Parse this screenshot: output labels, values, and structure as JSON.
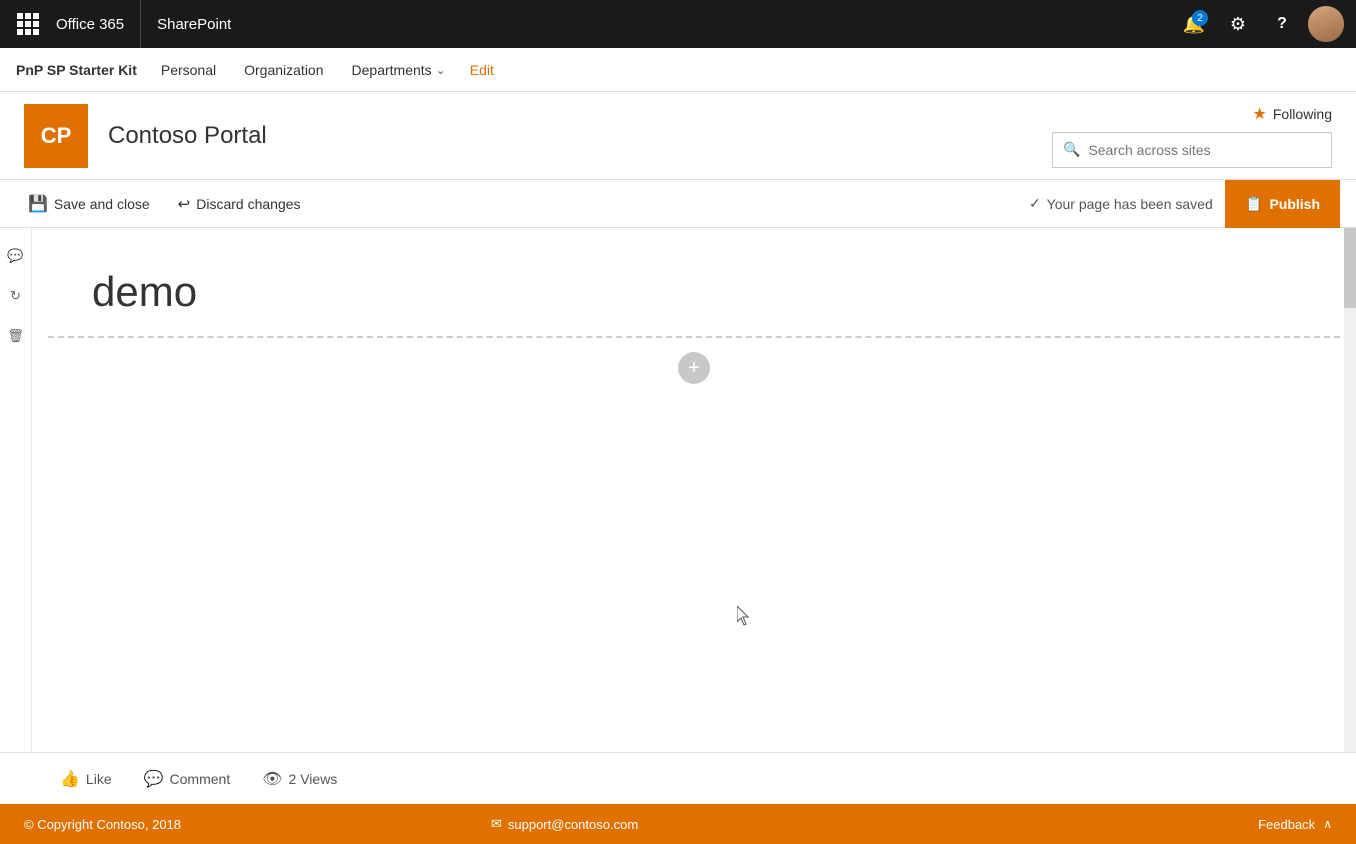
{
  "topBar": {
    "appName": "Office 365",
    "productName": "SharePoint",
    "notificationCount": "2",
    "settingsLabel": "Settings",
    "helpLabel": "Help",
    "avatarLabel": "User profile"
  },
  "siteNav": {
    "siteName": "PnP SP Starter Kit",
    "items": [
      {
        "id": "personal",
        "label": "Personal"
      },
      {
        "id": "organization",
        "label": "Organization"
      },
      {
        "id": "departments",
        "label": "Departments",
        "hasChevron": true
      },
      {
        "id": "edit",
        "label": "Edit",
        "isEdit": true
      }
    ]
  },
  "header": {
    "logoText": "CP",
    "siteTitle": "Contoso Portal",
    "followingLabel": "Following",
    "searchPlaceholder": "Search across sites"
  },
  "toolbar": {
    "saveAndCloseLabel": "Save and close",
    "discardChangesLabel": "Discard changes",
    "savedMessage": "Your page has been saved",
    "publishLabel": "Publish"
  },
  "pageContent": {
    "pageTitle": "demo",
    "addSectionTooltip": "Add a new section"
  },
  "bottomBar": {
    "likeLabel": "Like",
    "commentLabel": "Comment",
    "viewsLabel": "2 Views"
  },
  "footer": {
    "copyright": "© Copyright Contoso, 2018",
    "supportEmail": "support@contoso.com",
    "feedbackLabel": "Feedback"
  },
  "icons": {
    "waffle": "⊞",
    "notification": "🔔",
    "settings": "⚙",
    "help": "?",
    "search": "🔍",
    "save": "💾",
    "discard": "↩",
    "check": "✓",
    "publish": "📋",
    "star": "★",
    "like": "👍",
    "comment": "💬",
    "views": "👁",
    "email": "✉",
    "chevronDown": "⌄",
    "chevronUp": "∧",
    "plus": "+",
    "sidebarComment": "💬",
    "sidebarShare": "⟳",
    "sidebarDelete": "🗑"
  }
}
